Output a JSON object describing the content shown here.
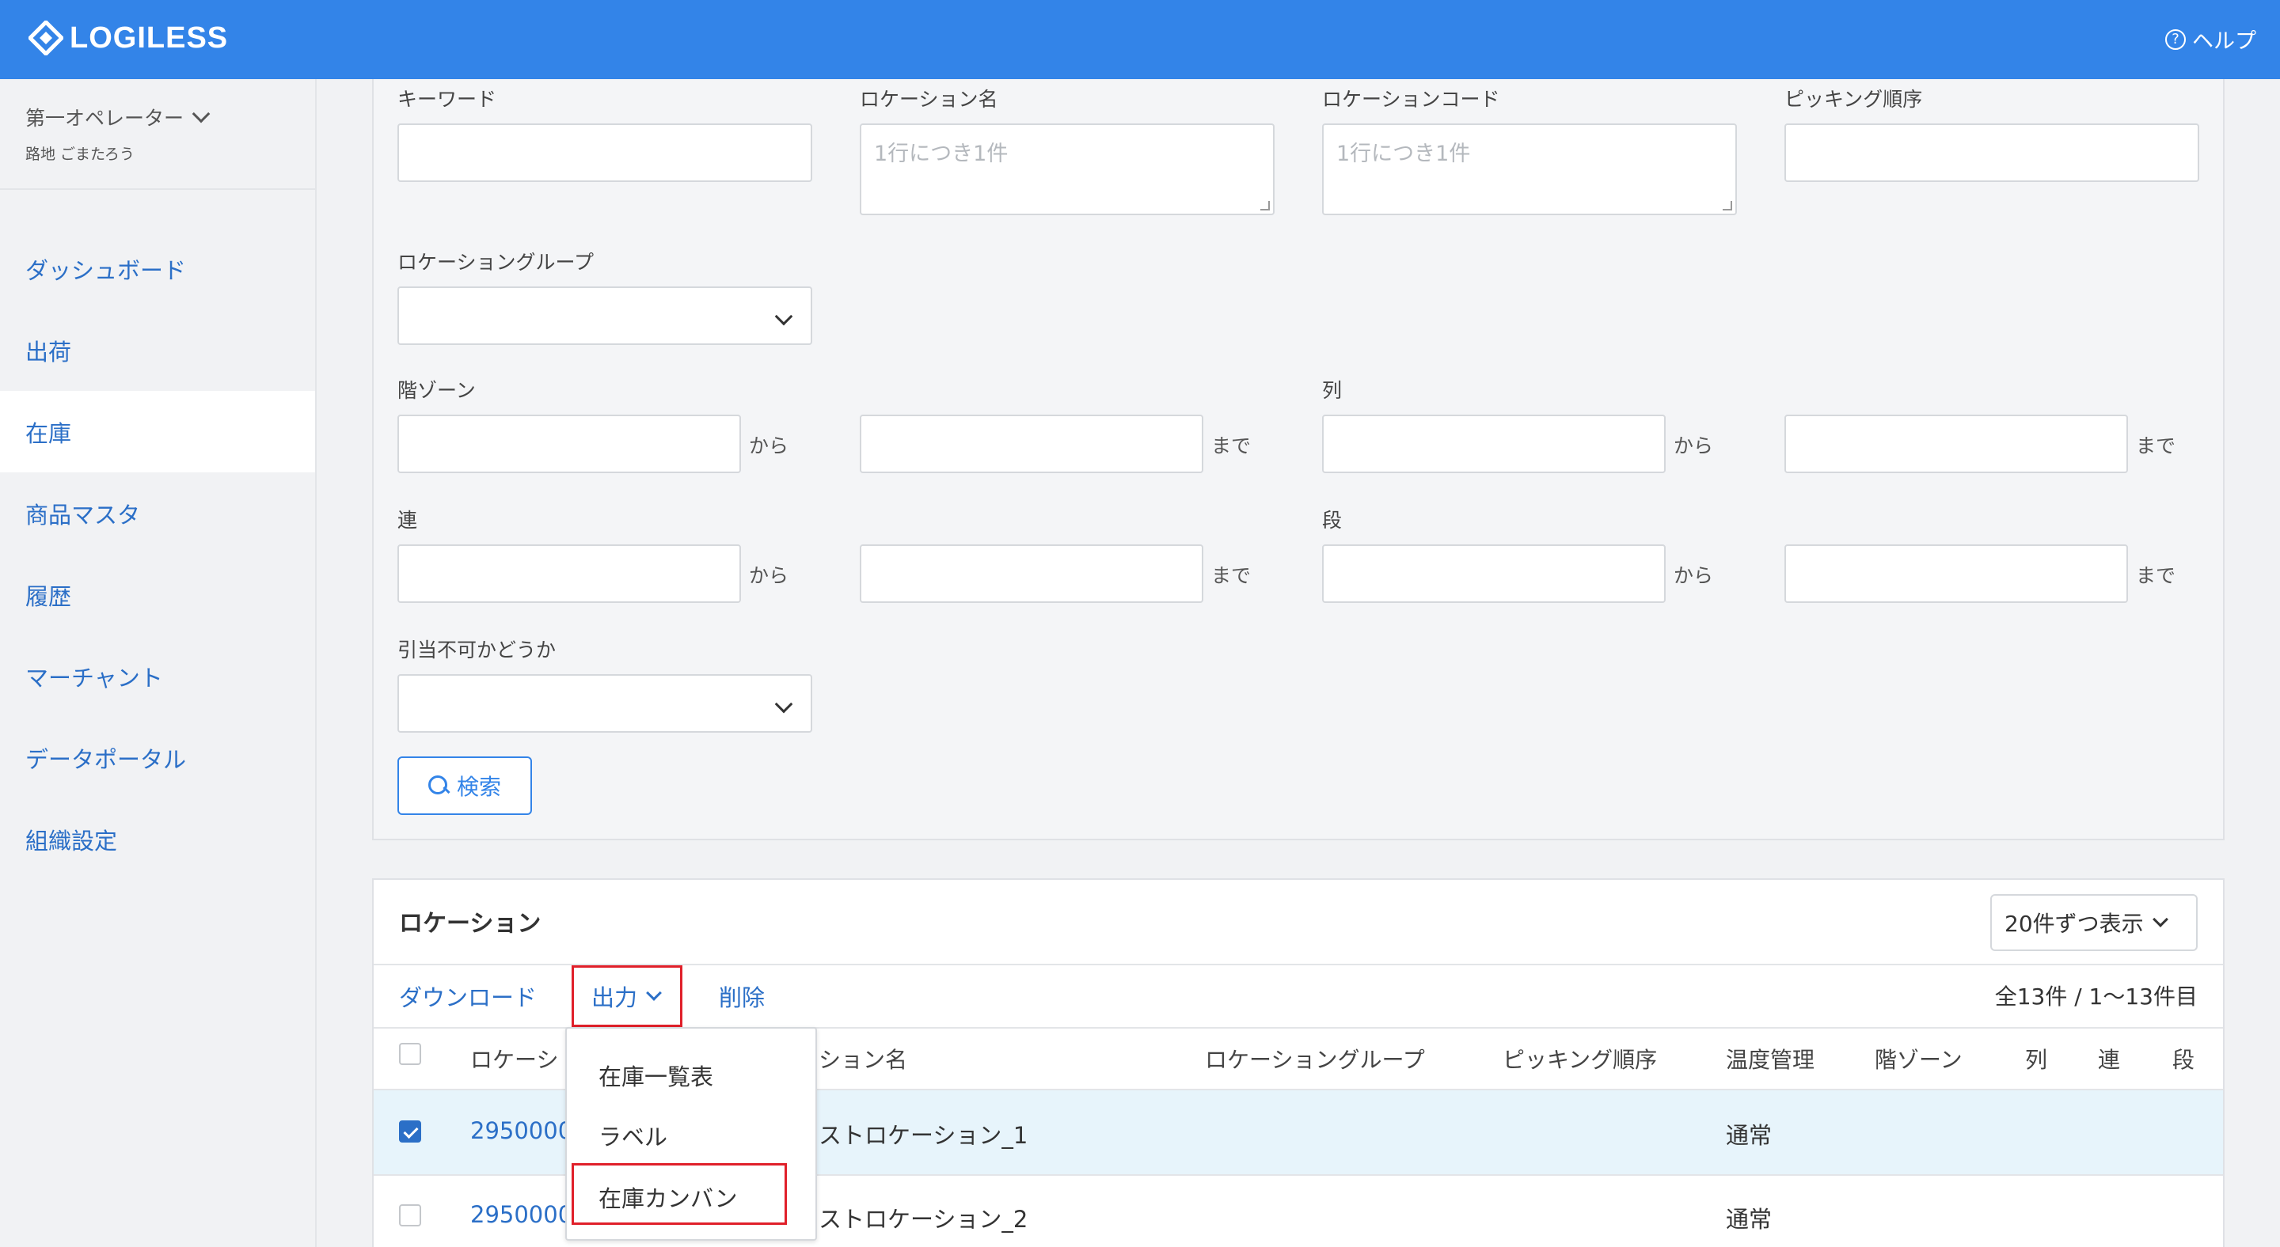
{
  "header": {
    "brand": "LOGILESS",
    "help_label": "ヘルプ",
    "help_icon": "question-circle-icon",
    "bg_color": "#3384e8"
  },
  "sidebar": {
    "operator_name": "第一オペレーター",
    "operator_sub": "路地 ごまたろう",
    "items": [
      {
        "label": "ダッシュボード",
        "active": false
      },
      {
        "label": "出荷",
        "active": false
      },
      {
        "label": "在庫",
        "active": true
      },
      {
        "label": "商品マスタ",
        "active": false
      },
      {
        "label": "履歴",
        "active": false
      },
      {
        "label": "マーチャント",
        "active": false
      },
      {
        "label": "データポータル",
        "active": false
      },
      {
        "label": "組織設定",
        "active": false
      }
    ]
  },
  "filters": {
    "keyword_label": "キーワード",
    "keyword_value": "",
    "location_name_label": "ロケーション名",
    "location_name_placeholder": "1行につき1件",
    "location_code_label": "ロケーションコード",
    "location_code_placeholder": "1行につき1件",
    "picking_order_label": "ピッキング順序",
    "location_group_label": "ロケーショングループ",
    "floor_zone_label": "階ゾーン",
    "column_label": "列",
    "ren_label": "連",
    "dan_label": "段",
    "from_suffix": "から",
    "to_suffix": "まで",
    "allocatable_label": "引当不可かどうか",
    "search_button": "検索"
  },
  "list": {
    "title": "ロケーション",
    "per_page": "20件ずつ表示",
    "actions": {
      "download": "ダウンロード",
      "output": "出力",
      "delete": "削除"
    },
    "count_text": "全13件 / 1〜13件目",
    "columns": [
      "ロケーシ",
      "ション名",
      "ロケーショングループ",
      "ピッキング順序",
      "温度管理",
      "階ゾーン",
      "列",
      "連",
      "段"
    ],
    "rows": [
      {
        "code": "2950000",
        "name": "ストロケーション_1",
        "temperature": "通常",
        "checked": true
      },
      {
        "code": "2950000",
        "name": "ストロケーション_2",
        "temperature": "通常",
        "checked": false
      }
    ]
  },
  "output_menu": {
    "items": [
      "在庫一覧表",
      "ラベル",
      "在庫カンバン"
    ],
    "highlighted_index": 2,
    "highlight_color": "#e0202a"
  }
}
